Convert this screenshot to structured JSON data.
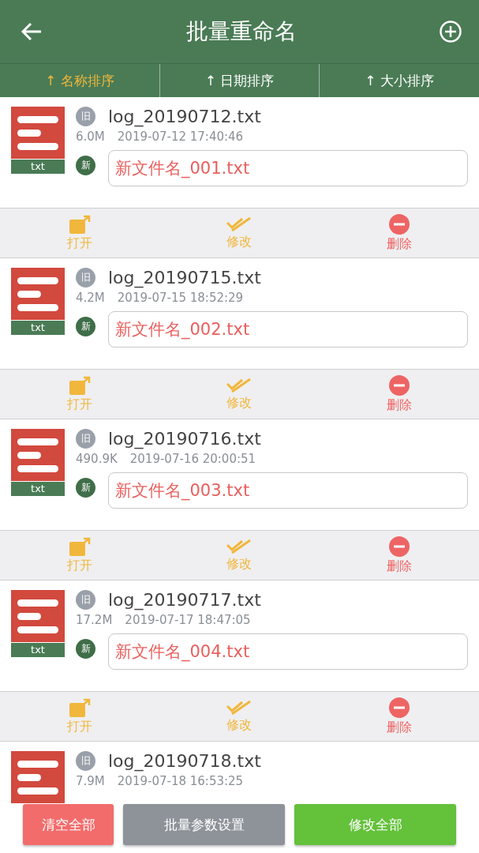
{
  "header": {
    "title": "批量重命名"
  },
  "sort_tabs": [
    {
      "label": "↑ 名称排序",
      "selected": true
    },
    {
      "label": "↑ 日期排序",
      "selected": false
    },
    {
      "label": "↑ 大小排序",
      "selected": false
    }
  ],
  "files": [
    {
      "type_label": "txt",
      "old_badge": "旧",
      "name": "log_20190712.txt",
      "size": "6.0M",
      "date": "2019-07-12 17:40:46",
      "new_badge": "新",
      "new_name": "新文件名_001.txt",
      "actions": [
        {
          "kind": "open",
          "label": "打开"
        },
        {
          "kind": "edit",
          "label": "修改"
        },
        {
          "kind": "delete",
          "label": "删除"
        }
      ]
    },
    {
      "type_label": "txt",
      "old_badge": "旧",
      "name": "log_20190715.txt",
      "size": "4.2M",
      "date": "2019-07-15 18:52:29",
      "new_badge": "新",
      "new_name": "新文件名_002.txt",
      "actions": [
        {
          "kind": "open",
          "label": "打开"
        },
        {
          "kind": "edit",
          "label": "修改"
        },
        {
          "kind": "delete",
          "label": "删除"
        }
      ]
    },
    {
      "type_label": "txt",
      "old_badge": "旧",
      "name": "log_20190716.txt",
      "size": "490.9K",
      "date": "2019-07-16 20:00:51",
      "new_badge": "新",
      "new_name": "新文件名_003.txt",
      "actions": [
        {
          "kind": "open",
          "label": "打开"
        },
        {
          "kind": "edit",
          "label": "修改"
        },
        {
          "kind": "delete",
          "label": "删除"
        }
      ]
    },
    {
      "type_label": "txt",
      "old_badge": "旧",
      "name": "log_20190717.txt",
      "size": "17.2M",
      "date": "2019-07-17 18:47:05",
      "new_badge": "新",
      "new_name": "新文件名_004.txt",
      "actions": [
        {
          "kind": "open",
          "label": "打开"
        },
        {
          "kind": "edit",
          "label": "修改"
        },
        {
          "kind": "delete",
          "label": "删除"
        }
      ]
    },
    {
      "old_badge": "旧",
      "name": "log_20190718.txt",
      "size": "7.9M",
      "date": "2019-07-18 16:53:25"
    }
  ],
  "bottom_buttons": [
    {
      "kind": "clear",
      "label": "清空全部"
    },
    {
      "kind": "settings",
      "label": "批量参数设置"
    },
    {
      "kind": "apply",
      "label": "修改全部"
    }
  ]
}
